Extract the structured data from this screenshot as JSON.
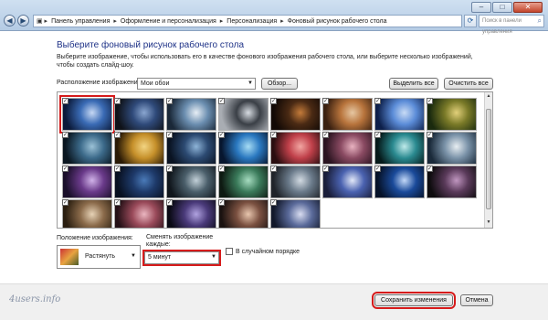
{
  "window": {
    "breadcrumb": [
      "Панель управления",
      "Оформление и персонализация",
      "Персонализация",
      "Фоновый рисунок рабочего стола"
    ],
    "search_placeholder": "Поиск в панели управления"
  },
  "header": {
    "title": "Выберите фоновый рисунок рабочего стола",
    "description": "Выберите изображение, чтобы использовать его в качестве фонового изображения рабочего стола, или выберите несколько изображений, чтобы создать слайд-шоу."
  },
  "location": {
    "label": "Расположение изображения:",
    "value": "Мои обои",
    "browse_label": "Обзор...",
    "select_all_label": "Выделить все",
    "clear_all_label": "Очистить все"
  },
  "gallery": {
    "tiles": [
      {
        "colors": [
          "#0b1a3a",
          "#3a6bb5",
          "#c6d8f4"
        ],
        "checked": true
      },
      {
        "colors": [
          "#0f1218",
          "#2f4a7a",
          "#8aa6d0"
        ],
        "checked": true
      },
      {
        "colors": [
          "#1a2838",
          "#6b8eb0",
          "#e7eef5"
        ],
        "checked": true
      },
      {
        "colors": [
          "#a9adb3",
          "#3a3f46",
          "#d7dce2"
        ],
        "checked": true
      },
      {
        "colors": [
          "#120905",
          "#4a2a14",
          "#c47b3a"
        ],
        "checked": true
      },
      {
        "colors": [
          "#3a2010",
          "#b8743c",
          "#e6c7a2"
        ],
        "checked": true
      },
      {
        "colors": [
          "#0d1f4a",
          "#5b8cd8",
          "#c8dbf5"
        ],
        "checked": true
      },
      {
        "colors": [
          "#1a2a0e",
          "#7a7a28",
          "#e2d07a"
        ],
        "checked": true
      },
      {
        "colors": [
          "#0a1620",
          "#3c6a8a",
          "#9bc1d6"
        ],
        "checked": true
      },
      {
        "colors": [
          "#2a1a06",
          "#c6902a",
          "#f2d482"
        ],
        "checked": true
      },
      {
        "colors": [
          "#0a1322",
          "#2c4a72",
          "#8eb4d8"
        ],
        "checked": true
      },
      {
        "colors": [
          "#07162e",
          "#2a78c0",
          "#a6dcf4"
        ],
        "checked": true
      },
      {
        "colors": [
          "#2a0e10",
          "#c0404a",
          "#f2a6a2"
        ],
        "checked": true
      },
      {
        "colors": [
          "#2a1420",
          "#8a4a62",
          "#e8b2c0"
        ],
        "checked": true
      },
      {
        "colors": [
          "#061a1a",
          "#2a8a90",
          "#bfeaea"
        ],
        "checked": true
      },
      {
        "colors": [
          "#1a2a3a",
          "#7a92a8",
          "#e8eef2"
        ],
        "checked": true
      },
      {
        "colors": [
          "#1a0f2a",
          "#6a3a8a",
          "#d0b2e8"
        ],
        "checked": true
      },
      {
        "colors": [
          "#081020",
          "#1e3a6a",
          "#4a7ab8"
        ],
        "checked": true
      },
      {
        "colors": [
          "#10161c",
          "#4a5e6a",
          "#c2d0d8"
        ],
        "checked": true
      },
      {
        "colors": [
          "#0e1a12",
          "#3a7a5a",
          "#a6dcc0"
        ],
        "checked": true
      },
      {
        "colors": [
          "#20242a",
          "#6a7a8a",
          "#d2dae2"
        ],
        "checked": true
      },
      {
        "colors": [
          "#1a1e3a",
          "#4a62b0",
          "#e2e8f8"
        ],
        "checked": true
      },
      {
        "colors": [
          "#061228",
          "#1a4a9a",
          "#c2d8f8"
        ],
        "checked": true
      },
      {
        "colors": [
          "#0e0c0e",
          "#5a3a5a",
          "#c096c0"
        ],
        "checked": true
      },
      {
        "colors": [
          "#2a1e10",
          "#8a6a4a",
          "#e6d2b6"
        ],
        "checked": true
      },
      {
        "colors": [
          "#241016",
          "#9a4a5a",
          "#eab6c0"
        ],
        "checked": true
      },
      {
        "colors": [
          "#0a0a14",
          "#4a3a7a",
          "#b0a2e0"
        ],
        "checked": true
      },
      {
        "colors": [
          "#1a1210",
          "#7a5040",
          "#e8c6ae"
        ],
        "checked": true
      },
      {
        "colors": [
          "#12182a",
          "#5a6a9a",
          "#d8dcf0"
        ],
        "checked": true
      }
    ]
  },
  "position": {
    "label": "Положение изображения:",
    "value": "Растянуть"
  },
  "interval": {
    "label": "Сменять изображение каждые:",
    "value": "5 минут"
  },
  "shuffle": {
    "label": "В случайном порядке"
  },
  "footer": {
    "save_label": "Сохранить изменения",
    "cancel_label": "Отмена",
    "logo": "4users.info"
  }
}
